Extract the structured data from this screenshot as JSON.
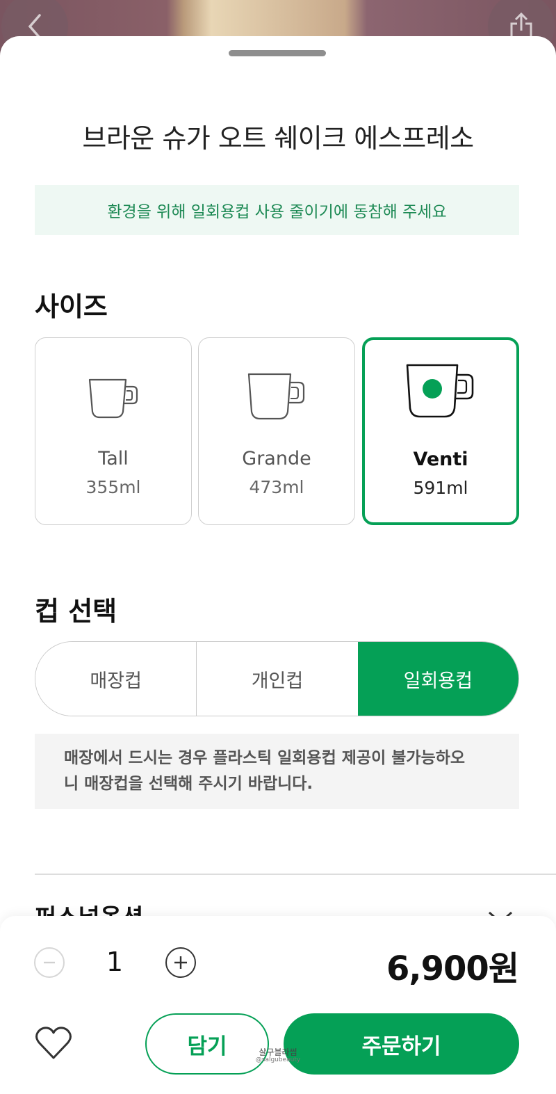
{
  "product": {
    "title": "브라운 슈가 오트 쉐이크 에스프레소"
  },
  "eco_banner": "환경을 위해 일회용컵 사용 줄이기에 동참해 주세요",
  "size_section": {
    "title": "사이즈",
    "options": [
      {
        "name": "Tall",
        "volume": "355ml",
        "selected": false
      },
      {
        "name": "Grande",
        "volume": "473ml",
        "selected": false
      },
      {
        "name": "Venti",
        "volume": "591ml",
        "selected": true
      }
    ]
  },
  "cup_section": {
    "title": "컵 선택",
    "options": [
      {
        "label": "매장컵",
        "selected": false
      },
      {
        "label": "개인컵",
        "selected": false
      },
      {
        "label": "일회용컵",
        "selected": true
      }
    ],
    "notice_line1": "매장에서 드시는 경우 플라스틱 일회용컵 제공이 불가능하오",
    "notice_line2": "니 매장컵을 선택해 주시기 바랍니다."
  },
  "personal_option": {
    "title": "퍼스널옵션"
  },
  "order_bar": {
    "quantity": "1",
    "price": "6,900원",
    "cart_label": "담기",
    "order_label": "주문하기"
  },
  "watermark": {
    "line1": "살구블라썸",
    "line2": "@salgubeauty"
  },
  "colors": {
    "accent": "#05a056",
    "eco_bg": "#eef8f3",
    "eco_text": "#1e8a55"
  }
}
